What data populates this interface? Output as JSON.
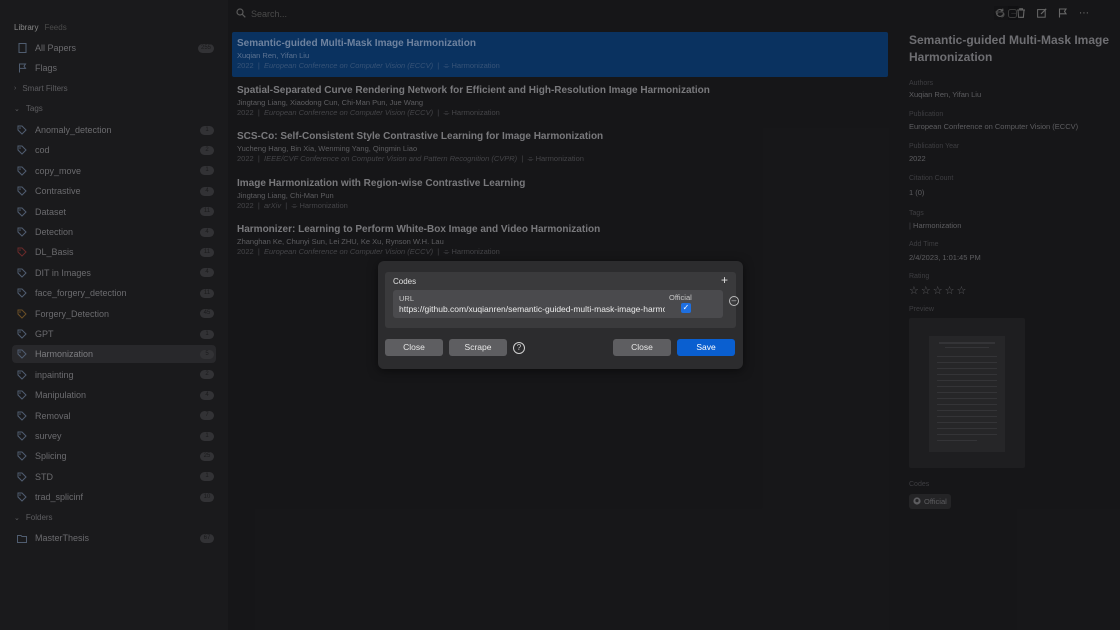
{
  "sidebar": {
    "tabs": [
      "Library",
      "Feeds"
    ],
    "all_papers": {
      "label": "All Papers",
      "count": "255"
    },
    "flags": {
      "label": "Flags"
    },
    "smart_filters": "Smart Filters",
    "tags_header": "Tags",
    "tags": [
      {
        "label": "Anomaly_detection",
        "count": "1",
        "color": "#5c6a80"
      },
      {
        "label": "cod",
        "count": "2",
        "color": "#5c6a80"
      },
      {
        "label": "copy_move",
        "count": "1",
        "color": "#5c6a80"
      },
      {
        "label": "Contrastive",
        "count": "4",
        "color": "#5c6a80"
      },
      {
        "label": "Dataset",
        "count": "11",
        "color": "#5c6a80"
      },
      {
        "label": "Detection",
        "count": "4",
        "color": "#5c6a80"
      },
      {
        "label": "DL_Basis",
        "count": "11",
        "color": "#7a3030"
      },
      {
        "label": "DIT in Images",
        "count": "4",
        "color": "#5c6a80"
      },
      {
        "label": "face_forgery_detection",
        "count": "11",
        "color": "#5c6a80"
      },
      {
        "label": "Forgery_Detection",
        "count": "45",
        "color": "#7a5a2c"
      },
      {
        "label": "GPT",
        "count": "1",
        "color": "#5c6a80"
      },
      {
        "label": "Harmonization",
        "count": "5",
        "color": "#5c6a80"
      },
      {
        "label": "inpainting",
        "count": "2",
        "color": "#5c6a80"
      },
      {
        "label": "Manipulation",
        "count": "4",
        "color": "#5c6a80"
      },
      {
        "label": "Removal",
        "count": "7",
        "color": "#5c6a80"
      },
      {
        "label": "survey",
        "count": "1",
        "color": "#5c6a80"
      },
      {
        "label": "Splicing",
        "count": "25",
        "color": "#5c6a80"
      },
      {
        "label": "STD",
        "count": "1",
        "color": "#5c6a80"
      },
      {
        "label": "trad_splicinf",
        "count": "10",
        "color": "#5c6a80"
      }
    ],
    "folders_header": "Folders",
    "folders": [
      {
        "label": "MasterThesis",
        "count": "67"
      }
    ]
  },
  "search": {
    "placeholder": "Search..."
  },
  "toolbar_icons": [
    "refresh-icon",
    "trash-icon",
    "edit-icon",
    "flag-icon",
    "undo-icon",
    "more-icon",
    "minimize-icon",
    "maximize-icon"
  ],
  "papers": [
    {
      "title": "Semantic-guided Multi-Mask Image Harmonization",
      "authors": "Xuqian Ren, Yifan Liu",
      "year": "2022",
      "venue": "European Conference on Computer Vision (ECCV)",
      "tag": "Harmonization"
    },
    {
      "title": "Spatial-Separated Curve Rendering Network for Efficient and High-Resolution Image Harmonization",
      "authors": "Jingtang Liang, Xiaodong Cun, Chi-Man Pun, Jue Wang",
      "year": "2022",
      "venue": "European Conference on Computer Vision (ECCV)",
      "tag": "Harmonization"
    },
    {
      "title": "SCS-Co: Self-Consistent Style Contrastive Learning for Image Harmonization",
      "authors": "Yucheng Hang, Bin Xia, Wenming Yang, Qingmin Liao",
      "year": "2022",
      "venue": "IEEE/CVF Conference on Computer Vision and Pattern Recognition (CVPR)",
      "tag": "Harmonization"
    },
    {
      "title": "Image Harmonization with Region-wise Contrastive Learning",
      "authors": "Jingtang Liang, Chi-Man Pun",
      "year": "2022",
      "venue": "arXiv",
      "tag": "Harmonization"
    },
    {
      "title": "Harmonizer: Learning to Perform White-Box Image and Video Harmonization",
      "authors": "Zhanghan Ke, Chunyi Sun, Lei ZHU, Ke Xu, Rynson W.H. Lau",
      "year": "2022",
      "venue": "European Conference on Computer Vision (ECCV)",
      "tag": "Harmonization"
    }
  ],
  "detail": {
    "title": "Semantic-guided Multi-Mask Image Harmonization",
    "authors_label": "Authors",
    "authors": "Xuqian Ren, Yifan Liu",
    "publication_label": "Publication",
    "publication": "European Conference on Computer Vision (ECCV)",
    "year_label": "Publication Year",
    "year": "2022",
    "citation_label": "Citation Count",
    "citation": "1 (0)",
    "tags_label": "Tags",
    "tags": "Harmonization",
    "added_label": "Add Time",
    "added": "2/4/2023, 1:01:45 PM",
    "rating_label": "Rating",
    "rating": 0,
    "rating_max": 5,
    "preview_label": "Preview",
    "codes_label": "Codes",
    "code_chip": "Official"
  },
  "modal": {
    "header": "Codes",
    "url_label": "URL",
    "url_value": "https://github.com/xuqianren/semantic-guided-multi-mask-image-harmonization",
    "official_label": "Official",
    "official_checked": true,
    "close_left": "Close",
    "scrape": "Scrape",
    "close_right": "Close",
    "save": "Save",
    "accent": "#0a5fd0"
  }
}
